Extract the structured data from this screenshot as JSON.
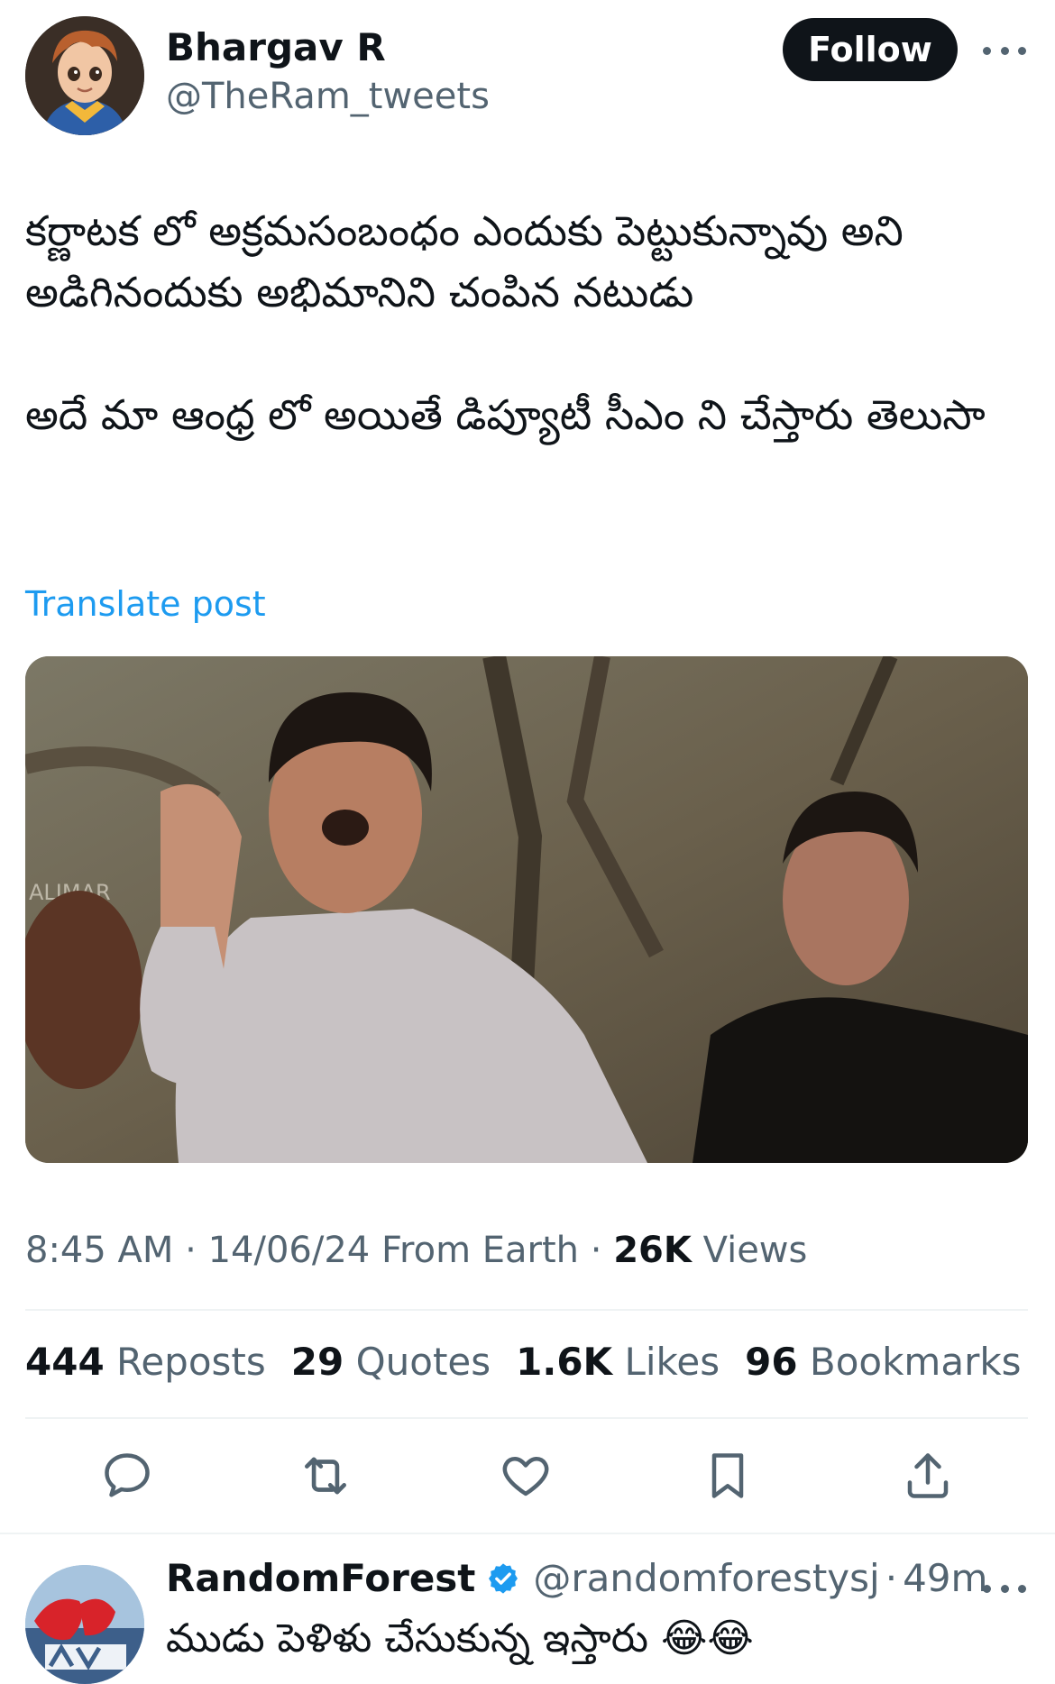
{
  "post": {
    "author_name": "Bhargav R",
    "author_handle": "@TheRam_tweets",
    "follow_label": "Follow",
    "text_paragraph_1": "కర్ణాటక లో అక్రమసంబంధం ఎందుకు పెట్టుకున్నావు అని అడిగినందుకు అభిమానిని చంపిన నటుడు",
    "text_paragraph_2": "అదే మా ఆంధ్ర లో అయితే డిప్యూటీ సీఎం ని చేస్తారు తెలుసా",
    "translate_label": "Translate post",
    "media_watermark": "ALIMAR",
    "time": "8:45 AM",
    "date": "14/06/24",
    "source": "From Earth",
    "views_count": "26K",
    "views_label": "Views",
    "stats": {
      "reposts_count": "444",
      "reposts_label": "Reposts",
      "quotes_count": "29",
      "quotes_label": "Quotes",
      "likes_count": "1.6K",
      "likes_label": "Likes",
      "bookmarks_count": "96",
      "bookmarks_label": "Bookmarks"
    },
    "actions": [
      "reply-icon",
      "repost-icon",
      "like-icon",
      "bookmark-icon",
      "share-icon"
    ]
  },
  "reply": {
    "author_name": "RandomForest",
    "verified": true,
    "author_handle": "@randomforestysj",
    "separator": "·",
    "time": "49m",
    "text": "ముడు పెళిళు చేసుకున్న ఇస్తారు 😂😂"
  },
  "colors": {
    "text": "#0f1419",
    "muted": "#536471",
    "link": "#1d9bf0",
    "follow_bg": "#0f1419",
    "divider": "#eff3f4"
  }
}
